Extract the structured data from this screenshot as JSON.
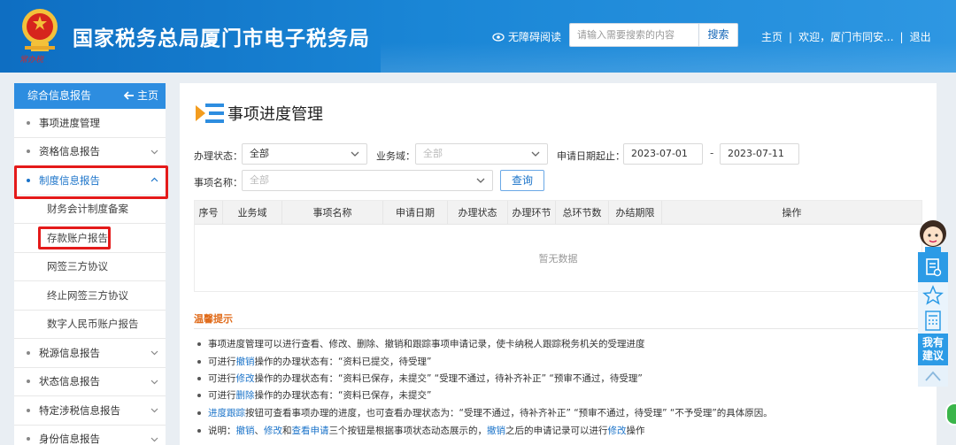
{
  "header": {
    "seal_text": "常办税",
    "title": "国家税务总局厦门市电子税务局",
    "accessibility": "无障碍阅读",
    "search_placeholder": "请输入需要搜索的内容",
    "search_button": "搜索",
    "home_link": "主页",
    "welcome": "欢迎，厦门市同安...",
    "logout": "退出"
  },
  "sidebar": {
    "head_title": "综合信息报告",
    "head_home": "主页",
    "items": [
      {
        "label": "事项进度管理",
        "type": "top"
      },
      {
        "label": "资格信息报告",
        "type": "top"
      },
      {
        "label": "制度信息报告",
        "type": "top"
      },
      {
        "label": "财务会计制度备案",
        "type": "sub"
      },
      {
        "label": "存款账户报告",
        "type": "sub"
      },
      {
        "label": "网签三方协议",
        "type": "sub"
      },
      {
        "label": "终止网签三方协议",
        "type": "sub"
      },
      {
        "label": "数字人民币账户报告",
        "type": "sub"
      },
      {
        "label": "税源信息报告",
        "type": "top"
      },
      {
        "label": "状态信息报告",
        "type": "top"
      },
      {
        "label": "特定涉税信息报告",
        "type": "top"
      },
      {
        "label": "身份信息报告",
        "type": "top"
      }
    ]
  },
  "main": {
    "title": "事项进度管理",
    "filters": {
      "status_label": "办理状态：",
      "status_value": "全部",
      "domain_label": "业务域：",
      "domain_value": "全部",
      "date_label": "申请日期起止：",
      "date_start": "2023-07-01",
      "date_sep": "-",
      "date_end": "2023-07-11",
      "name_label": "事项名称：",
      "name_value": "全部",
      "query_button": "查询"
    },
    "table": {
      "columns": [
        "序号",
        "业务域",
        "事项名称",
        "申请日期",
        "办理状态",
        "办理环节",
        "总环节数",
        "办结期限",
        "操作"
      ],
      "empty_text": "暂无数据"
    },
    "tips": {
      "title": "温馨提示",
      "lines": [
        {
          "parts": [
            {
              "t": "事项进度管理可以进行查看、修改、删除、撤销和跟踪事项申请记录，使卡纳税人跟踪税务机关的受理进度"
            }
          ]
        },
        {
          "parts": [
            {
              "t": "可进行"
            },
            {
              "t": "撤销",
              "k": true
            },
            {
              "t": "操作的办理状态有：“资料已提交，待受理”"
            }
          ]
        },
        {
          "parts": [
            {
              "t": "可进行"
            },
            {
              "t": "修改",
              "k": true
            },
            {
              "t": "操作的办理状态有：“资料已保存，未提交”   “受理不通过，待补齐补正”   “预审不通过，待受理”"
            }
          ]
        },
        {
          "parts": [
            {
              "t": "可进行"
            },
            {
              "t": "删除",
              "k": true
            },
            {
              "t": "操作的办理状态有：“资料已保存，未提交”"
            }
          ]
        },
        {
          "parts": [
            {
              "t": "进度跟踪",
              "k": true
            },
            {
              "t": "按钮可查看事项办理的进度，也可查看办理状态为：“受理不通过，待补齐补正”   “预审不通过，待受理”   “不予受理”的具体原因。"
            }
          ]
        },
        {
          "parts": [
            {
              "t": "说明："
            },
            {
              "t": "撤销",
              "k": true
            },
            {
              "t": "、"
            },
            {
              "t": "修改",
              "k": true
            },
            {
              "t": "和"
            },
            {
              "t": "查看申请",
              "k": true
            },
            {
              "t": "三个按钮是根据事项状态动态展示的，"
            },
            {
              "t": "撤销",
              "k": true
            },
            {
              "t": "之后的申请记录可以进行"
            },
            {
              "t": "修改",
              "k": true
            },
            {
              "t": "操作"
            }
          ]
        }
      ]
    }
  },
  "float": {
    "suggest": "我有建议"
  },
  "colors": {
    "header_blue": "#1a86d6",
    "accent_blue": "#2d8de0",
    "highlight_red": "#e41a1a",
    "tips_orange": "#e06b1a"
  }
}
